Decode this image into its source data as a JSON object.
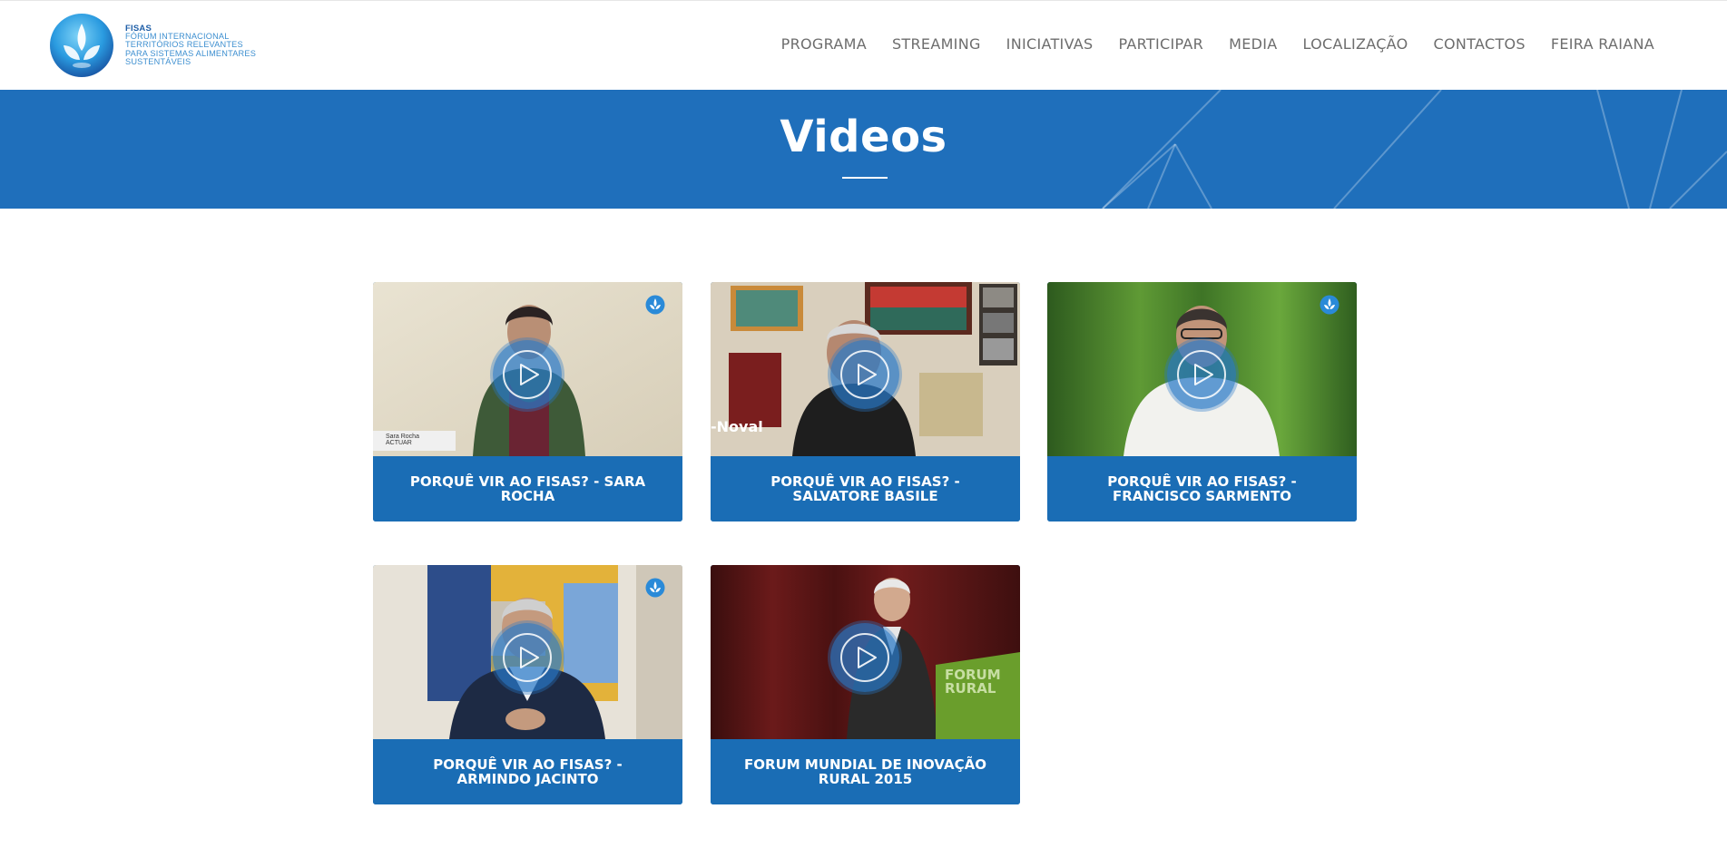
{
  "site": {
    "logo_brand": "FISAS",
    "logo_lines": [
      "FÓRUM INTERNACIONAL",
      "TERRITÓRIOS RELEVANTES",
      "PARA SISTEMAS ALIMENTARES",
      "SUSTENTÁVEIS"
    ]
  },
  "nav": {
    "items": [
      "PROGRAMA",
      "STREAMING",
      "INICIATIVAS",
      "PARTICIPAR",
      "MEDIA",
      "LOCALIZAÇÃO",
      "CONTACTOS",
      "FEIRA RAIANA"
    ]
  },
  "hero": {
    "title": "Videos"
  },
  "videos": [
    {
      "title": "PORQUÊ VIR AO FISAS? - SARA ROCHA",
      "lower_third_name": "Sara Rocha",
      "lower_third_org": "ACTUAR"
    },
    {
      "title": "PORQUÊ VIR AO FISAS? - SALVATORE BASILE",
      "overlay_text": "-Noval"
    },
    {
      "title": "PORQUÊ VIR AO FISAS? - FRANCISCO SARMENTO"
    },
    {
      "title": "PORQUÊ VIR AO FISAS? - ARMINDO JACINTO"
    },
    {
      "title": "FORUM MUNDIAL DE INOVAÇÃO RURAL 2015",
      "podium_line1": "FORUM",
      "podium_line2": "RURAL"
    }
  ],
  "colors": {
    "brand_blue": "#1f6fbb",
    "caption_blue": "#1a6db5",
    "nav_text": "#6d6d6d"
  },
  "icons": {
    "play": "play-icon",
    "corner": "fisas-drop-icon"
  }
}
